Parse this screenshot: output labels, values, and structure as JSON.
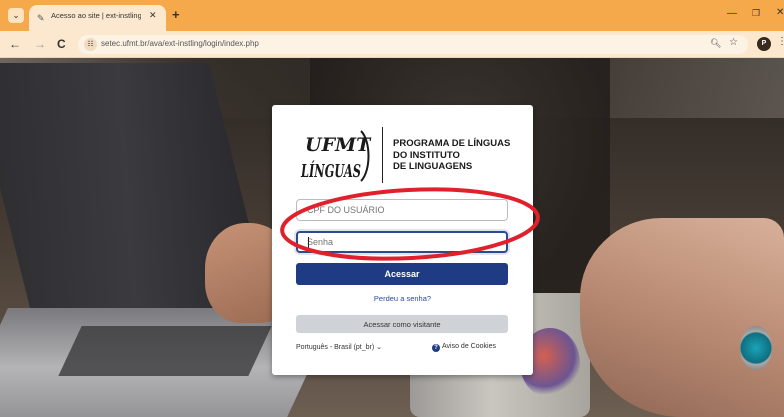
{
  "browser": {
    "tab_title": "Acesso ao site | ext-instling",
    "url": "setec.ufmt.br/ava/ext-instling/login/index.php",
    "profile_initial": "P"
  },
  "login": {
    "logo_mark_lines": [
      "UFMT",
      "LÍNGUAS"
    ],
    "program_title_lines": [
      "PROGRAMA DE LÍNGUAS",
      "DO INSTITUTO",
      "DE LINGUAGENS"
    ],
    "username_placeholder": "CPF DO USUÁRIO",
    "password_placeholder": "Senha",
    "login_button": "Acessar",
    "forgot_link": "Perdeu a senha?",
    "guest_button": "Acessar como visitante",
    "language_selector": "Português - Brasil (pt_br)",
    "cookies_link": "Aviso de Cookies"
  },
  "icons": {
    "tab_search": "chevron-down-icon",
    "favicon": "site-favicon-icon",
    "tab_close": "close-icon",
    "new_tab": "plus-icon",
    "back": "arrow-left-icon",
    "forward": "arrow-right-icon",
    "reload": "reload-icon",
    "site_info": "tune-icon",
    "zoom": "zoom-icon",
    "bookmark": "star-icon",
    "menu": "more-vertical-icon",
    "cookies": "help-circle-icon"
  },
  "colors": {
    "tab_strip": "#f6a94a",
    "primary_button": "#1f3b84",
    "annotation": "#e0202a"
  }
}
